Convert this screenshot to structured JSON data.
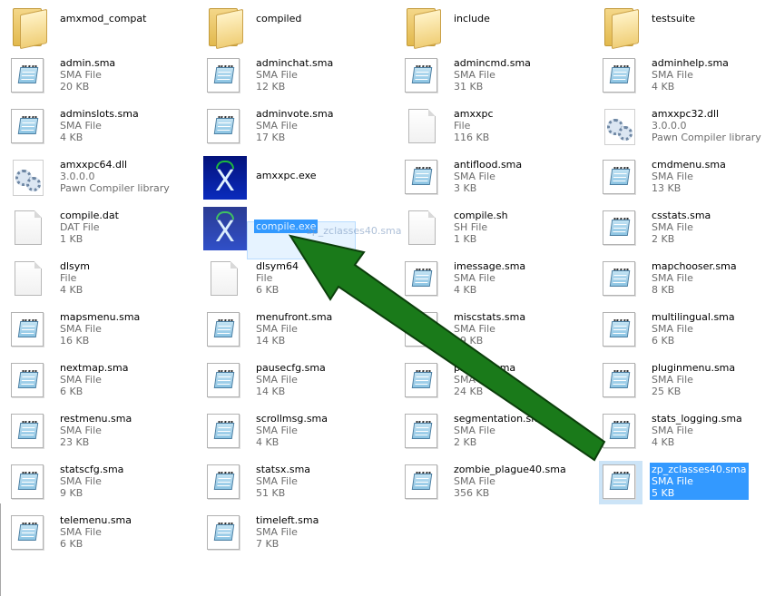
{
  "items": [
    {
      "name": "amxmod_compat",
      "type": "folder",
      "line2": "",
      "line3": ""
    },
    {
      "name": "compiled",
      "type": "folder",
      "line2": "",
      "line3": ""
    },
    {
      "name": "include",
      "type": "folder",
      "line2": "",
      "line3": ""
    },
    {
      "name": "testsuite",
      "type": "folder",
      "line2": "",
      "line3": ""
    },
    {
      "name": "admin.sma",
      "type": "doc",
      "line2": "SMA File",
      "line3": "20 KB"
    },
    {
      "name": "adminchat.sma",
      "type": "doc",
      "line2": "SMA File",
      "line3": "12 KB"
    },
    {
      "name": "admincmd.sma",
      "type": "doc",
      "line2": "SMA File",
      "line3": "31 KB"
    },
    {
      "name": "adminhelp.sma",
      "type": "doc",
      "line2": "SMA File",
      "line3": "4 KB"
    },
    {
      "name": "adminslots.sma",
      "type": "doc",
      "line2": "SMA File",
      "line3": "4 KB"
    },
    {
      "name": "adminvote.sma",
      "type": "doc",
      "line2": "SMA File",
      "line3": "17 KB"
    },
    {
      "name": "amxxpc",
      "type": "file",
      "line2": "File",
      "line3": "116 KB"
    },
    {
      "name": "amxxpc32.dll",
      "type": "dll",
      "line2": "3.0.0.0",
      "line3": "Pawn Compiler library"
    },
    {
      "name": "amxxpc64.dll",
      "type": "dll",
      "line2": "3.0.0.0",
      "line3": "Pawn Compiler library"
    },
    {
      "name": "amxxpc.exe",
      "type": "exe",
      "line2": "",
      "line3": ""
    },
    {
      "name": "antiflood.sma",
      "type": "doc",
      "line2": "SMA File",
      "line3": "3 KB"
    },
    {
      "name": "cmdmenu.sma",
      "type": "doc",
      "line2": "SMA File",
      "line3": "13 KB"
    },
    {
      "name": "compile.dat",
      "type": "file",
      "line2": "DAT File",
      "line3": "1 KB"
    },
    {
      "name": "compile.exe",
      "type": "exe",
      "line2": "",
      "line3": "",
      "selected": true
    },
    {
      "name": "compile.sh",
      "type": "file",
      "line2": "SH File",
      "line3": "1 KB"
    },
    {
      "name": "csstats.sma",
      "type": "doc",
      "line2": "SMA File",
      "line3": "2 KB"
    },
    {
      "name": "dlsym",
      "type": "file",
      "line2": "File",
      "line3": "4 KB"
    },
    {
      "name": "dlsym64",
      "type": "file",
      "line2": "File",
      "line3": "6 KB"
    },
    {
      "name": "imessage.sma",
      "type": "doc",
      "line2": "SMA File",
      "line3": "4 KB"
    },
    {
      "name": "mapchooser.sma",
      "type": "doc",
      "line2": "SMA File",
      "line3": "8 KB"
    },
    {
      "name": "mapsmenu.sma",
      "type": "doc",
      "line2": "SMA File",
      "line3": "16 KB"
    },
    {
      "name": "menufront.sma",
      "type": "doc",
      "line2": "SMA File",
      "line3": "14 KB"
    },
    {
      "name": "miscstats.sma",
      "type": "doc",
      "line2": "SMA File",
      "line3": "19 KB"
    },
    {
      "name": "multilingual.sma",
      "type": "doc",
      "line2": "SMA File",
      "line3": "6 KB"
    },
    {
      "name": "nextmap.sma",
      "type": "doc",
      "line2": "SMA File",
      "line3": "6 KB"
    },
    {
      "name": "pausecfg.sma",
      "type": "doc",
      "line2": "SMA File",
      "line3": "14 KB"
    },
    {
      "name": "plmenu.sma",
      "type": "doc",
      "line2": "SMA File",
      "line3": "24 KB"
    },
    {
      "name": "pluginmenu.sma",
      "type": "doc",
      "line2": "SMA File",
      "line3": "25 KB"
    },
    {
      "name": "restmenu.sma",
      "type": "doc",
      "line2": "SMA File",
      "line3": "23 KB"
    },
    {
      "name": "scrollmsg.sma",
      "type": "doc",
      "line2": "SMA File",
      "line3": "4 KB"
    },
    {
      "name": "segmentation.sma",
      "type": "doc",
      "line2": "SMA File",
      "line3": "2 KB"
    },
    {
      "name": "stats_logging.sma",
      "type": "doc",
      "line2": "SMA File",
      "line3": "4 KB"
    },
    {
      "name": "statscfg.sma",
      "type": "doc",
      "line2": "SMA File",
      "line3": "9 KB"
    },
    {
      "name": "statsx.sma",
      "type": "doc",
      "line2": "SMA File",
      "line3": "51 KB"
    },
    {
      "name": "zombie_plague40.sma",
      "type": "doc",
      "line2": "SMA File",
      "line3": "356 KB"
    },
    {
      "name": "zp_zclasses40.sma",
      "type": "doc",
      "line2": "SMA File",
      "line3": "5 KB",
      "selected": true
    },
    {
      "name": "telemenu.sma",
      "type": "doc",
      "line2": "SMA File",
      "line3": "6 KB"
    },
    {
      "name": "timeleft.sma",
      "type": "doc",
      "line2": "SMA File",
      "line3": "7 KB"
    }
  ],
  "drag_ghost": {
    "name": "zp_zclasses40.sma"
  },
  "colors": {
    "arrow": "#1a7a1a",
    "selection": "#3399ff"
  }
}
